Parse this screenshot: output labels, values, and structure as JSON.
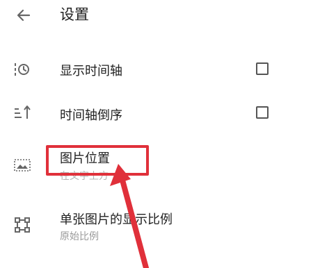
{
  "header": {
    "title": "设置",
    "back_icon": "arrow-left-icon"
  },
  "settings": [
    {
      "id": "timeline",
      "label": "显示时间轴",
      "icon": "timeline-clock-icon",
      "checkbox": false
    },
    {
      "id": "reverse",
      "label": "时间轴倒序",
      "icon": "sort-ascending-icon",
      "checkbox": false
    },
    {
      "id": "image_position",
      "label": "图片位置",
      "sublabel": "在文字上方",
      "icon": "image-frame-icon"
    },
    {
      "id": "ratio",
      "label": "单张图片的显示比例",
      "sublabel": "原始比例",
      "icon": "crop-frame-icon"
    }
  ],
  "annotation": {
    "highlight_color": "#e0303a",
    "arrow_color": "#e0303a"
  }
}
